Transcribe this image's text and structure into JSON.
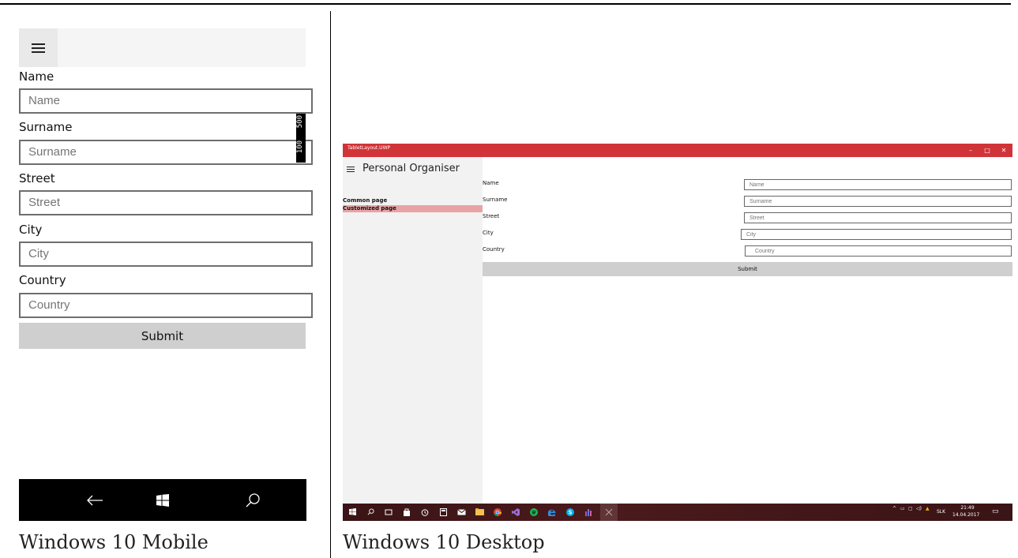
{
  "mobile": {
    "caption": "Windows 10 Mobile",
    "form": {
      "name_label": "Name",
      "name_placeholder": "Name",
      "surname_label": "Surname",
      "surname_placeholder": "Surname",
      "street_label": "Street",
      "street_placeholder": "Street",
      "city_label": "City",
      "city_placeholder": "City",
      "country_label": "Country",
      "country_placeholder": "Country",
      "submit_label": "Submit"
    },
    "overlay_badge": {
      "top": "500",
      "bottom": "100"
    },
    "navbar": {
      "back_icon": "←",
      "windows_icon": "windows-logo",
      "search_icon": "⚲"
    }
  },
  "desktop": {
    "caption": "Windows 10 Desktop",
    "window_title": "TabletLayout.UWP",
    "window_buttons": {
      "minimize": "–",
      "maximize": "□",
      "close": "✕"
    },
    "app_title": "Personal Organiser",
    "nav": {
      "items": [
        {
          "label": "Common page"
        },
        {
          "label": "Customized page"
        }
      ]
    },
    "form": {
      "name_label": "Name",
      "name_placeholder": "Name",
      "surname_label": "Surname",
      "surname_placeholder": "Surname",
      "street_label": "Street",
      "street_placeholder": "Street",
      "city_label": "City",
      "city_placeholder": "City",
      "country_label": "Country",
      "country_placeholder": "Country",
      "submit_label": "Submit"
    },
    "taskbar": {
      "language": "SLK",
      "time": "21:49",
      "date": "14.04.2017"
    }
  },
  "colors": {
    "accent": "#d13438",
    "selected_nav": "#e8a3a5",
    "submit_bg": "#cfcfcf"
  }
}
